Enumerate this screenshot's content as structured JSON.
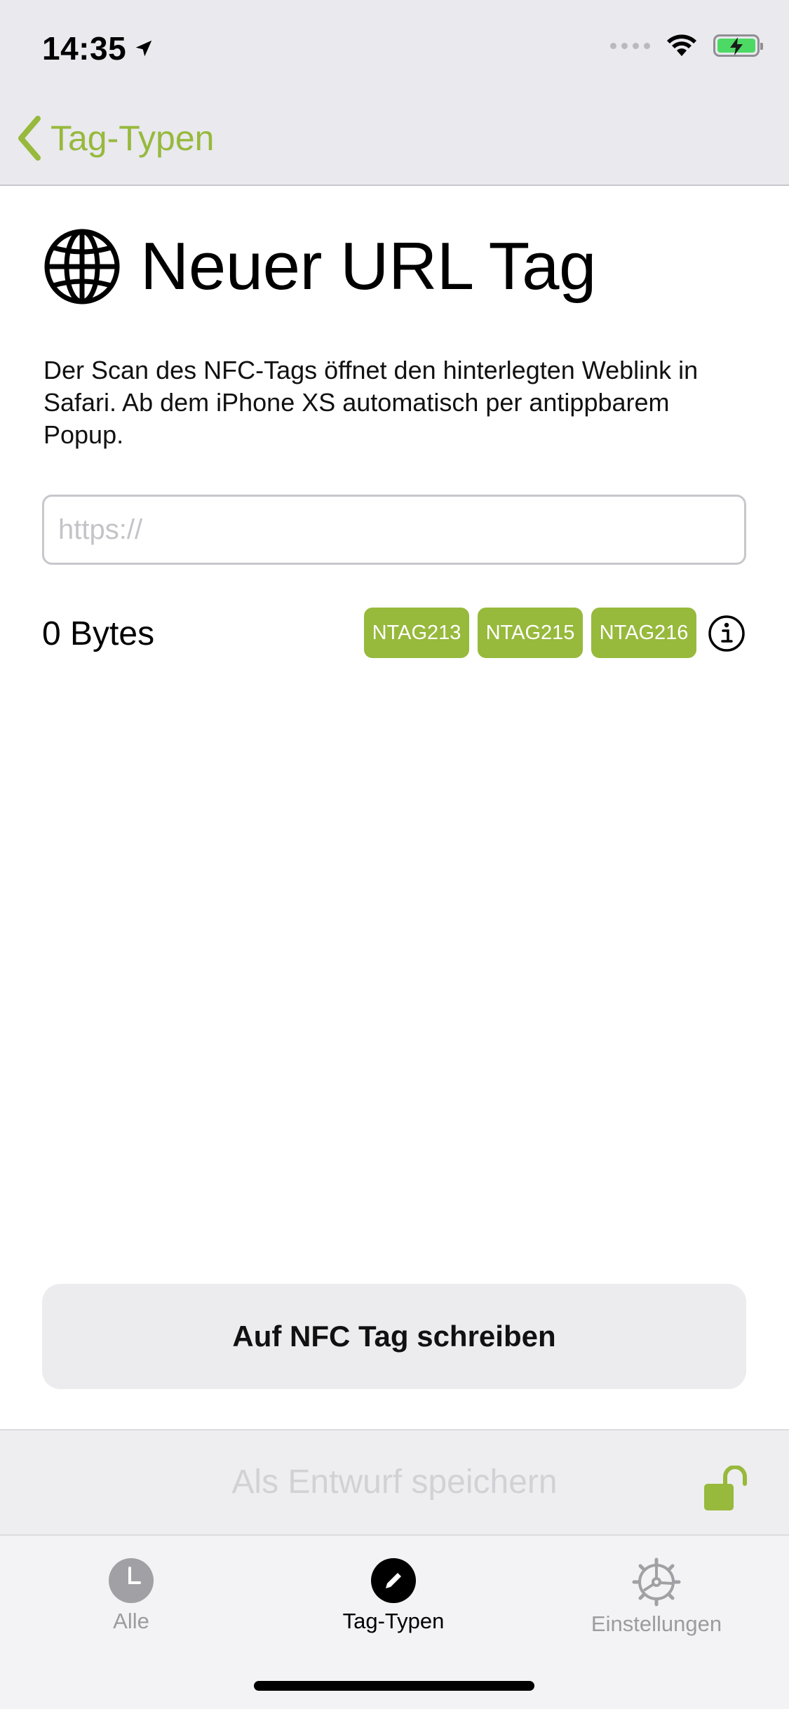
{
  "status_bar": {
    "time": "14:35"
  },
  "nav": {
    "back_label": "Tag-Typen"
  },
  "content": {
    "title": "Neuer URL Tag",
    "title_icon": "globe-icon",
    "description": "Der Scan des NFC-Tags öffnet den hinterlegten Weblink in Safari. Ab dem iPhone XS automatisch per antippbarem Popup.",
    "url_field": {
      "value": "",
      "placeholder": "https://"
    },
    "bytes_label": "0 Bytes",
    "tag_chips": [
      "NTAG213",
      "NTAG215",
      "NTAG216"
    ],
    "info_icon": "info-icon"
  },
  "actions": {
    "write_label": "Auf NFC Tag schreiben",
    "save_draft_label": "Als Entwurf speichern",
    "lock_icon": "unlocked-padlock-icon"
  },
  "tab_bar": {
    "items": [
      {
        "label": "Alle",
        "icon": "clock-icon",
        "active": false
      },
      {
        "label": "Tag-Typen",
        "icon": "pencil-icon",
        "active": true
      },
      {
        "label": "Einstellungen",
        "icon": "gear-icon",
        "active": false
      }
    ]
  },
  "colors": {
    "accent": "#97b93c",
    "nav_background": "#e9e9ee",
    "inactive_tab": "#9b9ba0",
    "battery_fill": "#4cd964"
  }
}
